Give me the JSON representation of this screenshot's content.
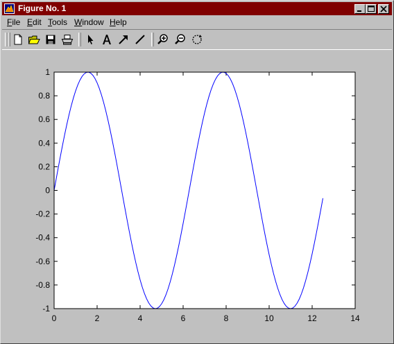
{
  "window": {
    "title": "Figure No. 1"
  },
  "menu": {
    "items": [
      "File",
      "Edit",
      "Tools",
      "Window",
      "Help"
    ],
    "underline_index": [
      0,
      0,
      0,
      0,
      0
    ]
  },
  "toolbar": {
    "buttons": [
      "new-file-icon",
      "open-folder-icon",
      "save-icon",
      "print-icon",
      "select-arrow-icon",
      "insert-text-icon",
      "insert-arrow-icon",
      "insert-line-icon",
      "zoom-in-icon",
      "zoom-out-icon",
      "rotate-3d-icon"
    ]
  },
  "colors": {
    "title_bar": "#800000",
    "line": "#0000ff",
    "background": "#c0c0c0",
    "axes_background": "#ffffff"
  },
  "chart_data": {
    "type": "line",
    "title": "",
    "xlabel": "",
    "ylabel": "",
    "xlim": [
      0,
      14
    ],
    "ylim": [
      -1,
      1
    ],
    "grid": false,
    "xticks": [
      0,
      2,
      4,
      6,
      8,
      10,
      12,
      14
    ],
    "yticks": [
      -1,
      -0.8,
      -0.6,
      -0.4,
      -0.2,
      0,
      0.2,
      0.4,
      0.6,
      0.8,
      1
    ],
    "xtick_labels": [
      "0",
      "2",
      "4",
      "6",
      "8",
      "10",
      "12",
      "14"
    ],
    "ytick_labels": [
      "-1",
      "-0.8",
      "-0.6",
      "-0.4",
      "-0.2",
      "0",
      "0.2",
      "0.4",
      "0.6",
      "0.8",
      "1"
    ],
    "series": [
      {
        "color": "#0000ff",
        "x_start": 0,
        "x_end": 12.566,
        "x_step": 0.1,
        "function": "sin(x)",
        "x": [
          0,
          1,
          1.571,
          2,
          3,
          3.142,
          4,
          4.712,
          5,
          6,
          6.283,
          7,
          7.854,
          8,
          9,
          9.425,
          10,
          10.996,
          12,
          12.5
        ],
        "y": [
          0,
          0.841,
          1,
          0.909,
          0.141,
          0,
          -0.757,
          -1,
          -0.959,
          -0.279,
          0,
          0.657,
          1,
          0.989,
          0.412,
          0,
          -0.544,
          -1,
          -0.537,
          -0.066
        ]
      }
    ]
  }
}
